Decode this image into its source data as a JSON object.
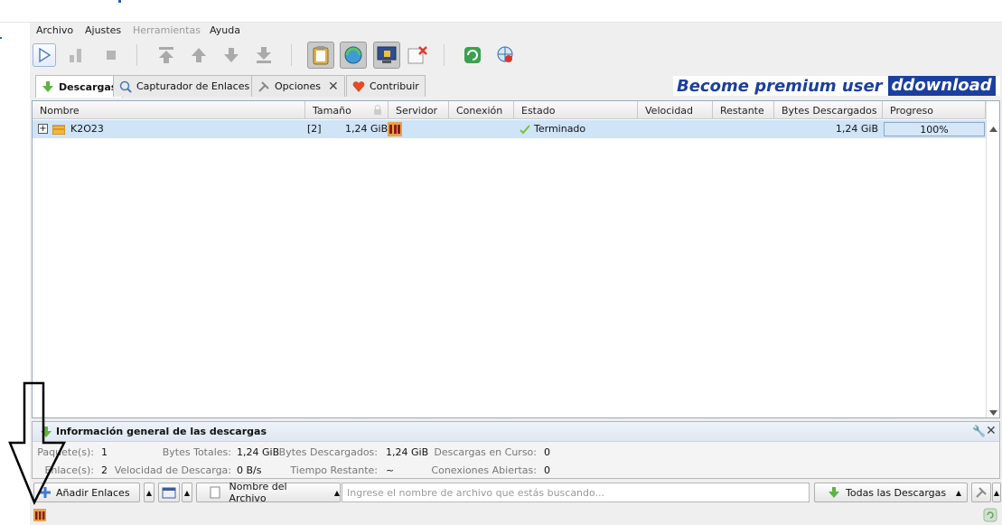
{
  "menu": {
    "archivo": "Archivo",
    "ajustes": "Ajustes",
    "herramientas": "Herramientas",
    "ayuda": "Ayuda"
  },
  "tabs": [
    {
      "label": "Descargas",
      "active": true
    },
    {
      "label": "Capturador de Enlaces"
    },
    {
      "label": "Opciones"
    },
    {
      "label": "Contribuir"
    }
  ],
  "banner": {
    "text": "Become premium user",
    "brand": "ddownload"
  },
  "table": {
    "columns": [
      "Nombre",
      "Tamaño",
      "Servidor",
      "Conexión",
      "Estado",
      "Velocidad",
      "Restante",
      "Bytes Descargados",
      "Progreso"
    ],
    "rows": [
      {
        "expand": "+",
        "name": "K2O23",
        "count": "[2]",
        "size": "1,24 GiB",
        "status": "Terminado",
        "bytes": "1,24 GiB",
        "progress": "100%",
        "progress_value": 1.0
      }
    ]
  },
  "info": {
    "title": "Información general de las descargas",
    "paquetes_label": "Paquete(s):",
    "paquetes_value": "1",
    "enlaces_label": "Enlace(s):",
    "enlaces_value": "2",
    "bytes_totales_label": "Bytes Totales:",
    "bytes_totales_value": "1,24 GiB",
    "velocidad_label": "Velocidad de Descarga:",
    "velocidad_value": "0 B/s",
    "bytes_desc_label": "Bytes Descargados:",
    "bytes_desc_value": "1,24 GiB",
    "tiempo_label": "Tiempo Restante:",
    "tiempo_value": "~",
    "en_curso_label": "Descargas en Curso:",
    "en_curso_value": "0",
    "conexiones_label": "Conexiones Abiertas:",
    "conexiones_value": "0"
  },
  "bottom": {
    "add_links": "Añadir Enlaces",
    "search_field": "Nombre del Archivo",
    "search_placeholder": "Ingrese el nombre de archivo que estás buscando...",
    "filter": "Todas las Descargas"
  },
  "colors": {
    "selected_row": "#cfe4f7",
    "banner_blue": "#1b3f9e",
    "progress_fill": "#d5e7f7"
  }
}
